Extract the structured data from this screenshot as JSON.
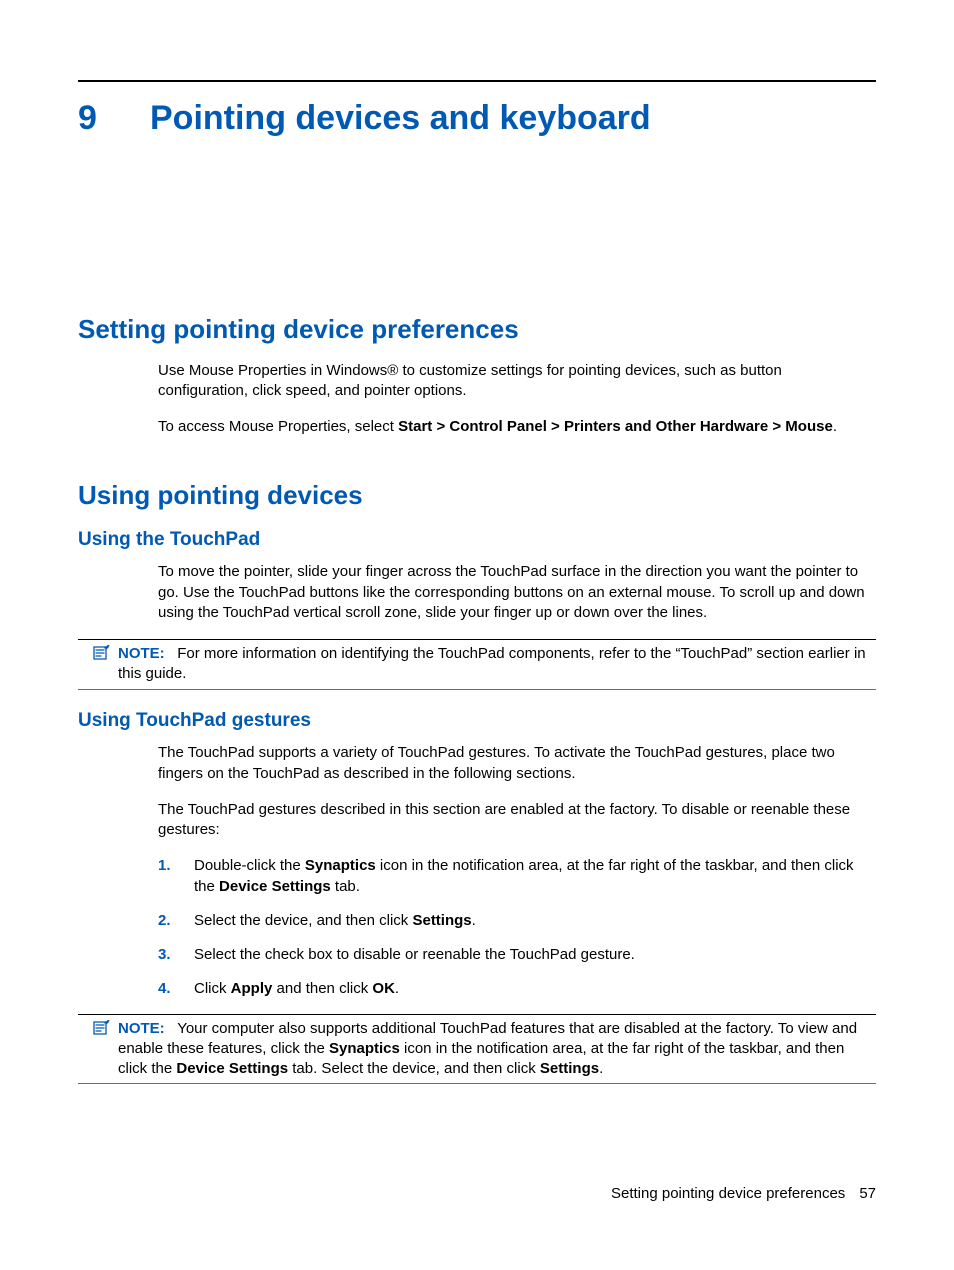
{
  "chapter": {
    "number": "9",
    "title": "Pointing devices and keyboard"
  },
  "section1": {
    "title": "Setting pointing device preferences",
    "p1": "Use Mouse Properties in Windows® to customize settings for pointing devices, such as button configuration, click speed, and pointer options.",
    "p2_before": "To access Mouse Properties, select ",
    "p2_bold": "Start > Control Panel > Printers and Other Hardware > Mouse",
    "p2_after": "."
  },
  "section2": {
    "title": "Using pointing devices",
    "sub1": {
      "title": "Using the TouchPad",
      "p1": "To move the pointer, slide your finger across the TouchPad surface in the direction you want the pointer to go. Use the TouchPad buttons like the corresponding buttons on an external mouse. To scroll up and down using the TouchPad vertical scroll zone, slide your finger up or down over the lines.",
      "note_label": "NOTE:",
      "note_text": "For more information on identifying the TouchPad components, refer to the “TouchPad” section earlier in this guide."
    },
    "sub2": {
      "title": "Using TouchPad gestures",
      "p1": "The TouchPad supports a variety of TouchPad gestures. To activate the TouchPad gestures, place two fingers on the TouchPad as described in the following sections.",
      "p2": "The TouchPad gestures described in this section are enabled at the factory. To disable or reenable these gestures:",
      "steps": [
        {
          "n": "1.",
          "pre": "Double-click the ",
          "b1": "Synaptics",
          "mid": " icon in the notification area, at the far right of the taskbar, and then click the ",
          "b2": "Device Settings",
          "post": " tab."
        },
        {
          "n": "2.",
          "pre": "Select the device, and then click ",
          "b1": "Settings",
          "mid": "",
          "b2": "",
          "post": "."
        },
        {
          "n": "3.",
          "pre": "Select the check box to disable or reenable the TouchPad gesture.",
          "b1": "",
          "mid": "",
          "b2": "",
          "post": ""
        },
        {
          "n": "4.",
          "pre": "Click ",
          "b1": "Apply",
          "mid": " and then click ",
          "b2": "OK",
          "post": "."
        }
      ],
      "note2": {
        "label": "NOTE:",
        "t1": "Your computer also supports additional TouchPad features that are disabled at the factory. To view and enable these features, click the ",
        "b1": "Synaptics",
        "t2": " icon in the notification area, at the far right of the taskbar, and then click the ",
        "b2": "Device Settings",
        "t3": " tab. Select the device, and then click ",
        "b3": "Settings",
        "t4": "."
      }
    }
  },
  "footer": {
    "text": "Setting pointing device preferences",
    "page": "57"
  }
}
